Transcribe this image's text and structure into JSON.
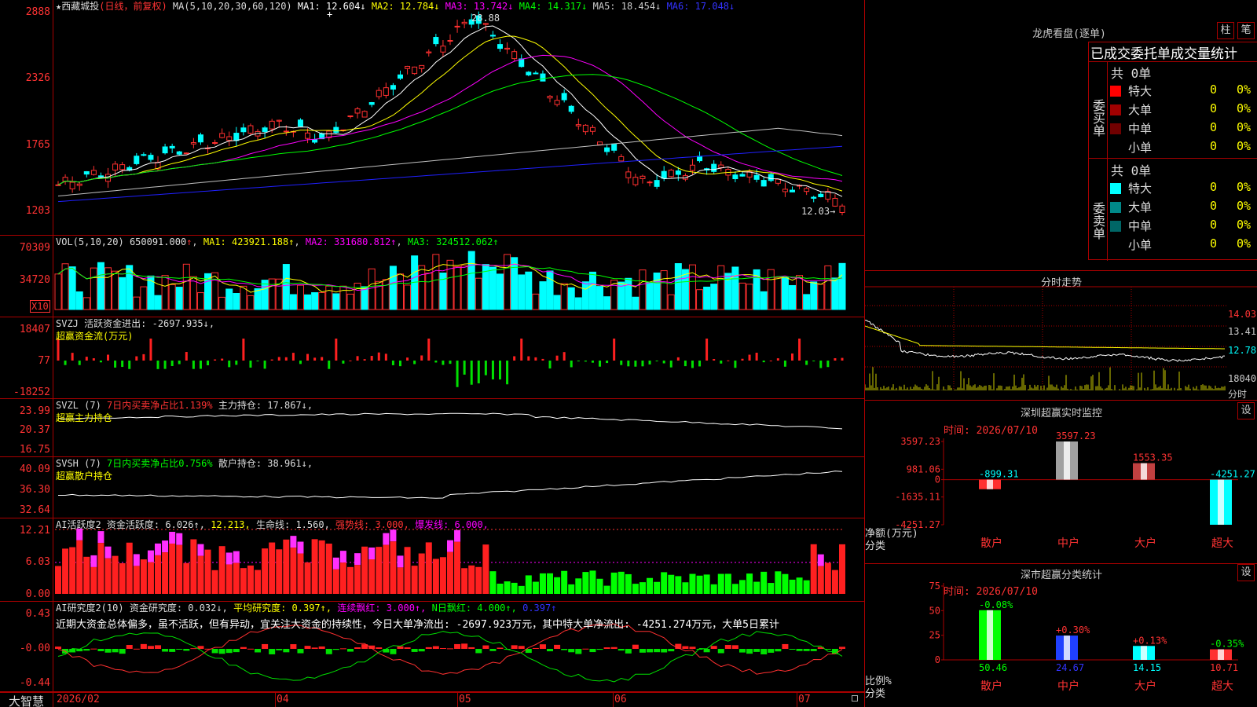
{
  "main": {
    "title": "★西藏城投",
    "period": "(日线，前复权)",
    "ma_label": "MA(5,10,20,30,60,120)",
    "ma": [
      {
        "name": "MA1: 12.604↓",
        "color": "#ffffff"
      },
      {
        "name": "MA2: 12.784↓",
        "color": "#ffff00"
      },
      {
        "name": "MA3: 13.742↓",
        "color": "#ff00ff"
      },
      {
        "name": "MA4: 14.317↓",
        "color": "#00ff00"
      },
      {
        "name": "MA5: 18.454↓",
        "color": "#c0c0c0"
      },
      {
        "name": "MA6: 17.048↓",
        "color": "#0000ff"
      }
    ],
    "yticks": [
      "2888",
      "2326",
      "1765",
      "1203"
    ],
    "high_label": "28.88",
    "low_label": "12.03→"
  },
  "vol": {
    "label": "VOL(5,10,20)",
    "value": "650091.000",
    "arrow": "↑",
    "ma1": "MA1: 423921.188↑",
    "ma2": "MA2: 331680.812↑",
    "ma3": "MA3: 324512.062↑",
    "yticks": [
      "70309",
      "34720"
    ],
    "unit": "X10"
  },
  "svzj": {
    "label": "SVZJ",
    "desc": "活跃资金进出: -2697.935↓,",
    "sub": "超赢资金流(万元)",
    "yticks": [
      "18407",
      "77",
      "-18252"
    ]
  },
  "svzl": {
    "label": "SVZL (7)",
    "desc1": "7日内买卖净占比1.139%",
    "desc2": "主力持仓: 17.867↓,",
    "sub": "超赢主力持仓",
    "yticks": [
      "23.99",
      "20.37",
      "16.75"
    ]
  },
  "svsh": {
    "label": "SVSH (7)",
    "desc1": "7日内买卖净占比0.756%",
    "desc2": "散户持仓: 38.961↓,",
    "sub": "超赢散户持仓",
    "yticks": [
      "40.09",
      "36.30",
      "32.64"
    ]
  },
  "ai1": {
    "label": "AI活跃度2",
    "a": "资金活跃度: 6.026↑,",
    "b": "12.213,",
    "c": "生命线: 1.560,",
    "d": "强势线: 3.000,",
    "e": "爆发线: 6.000,",
    "yticks": [
      "12.21",
      "6.03",
      "0.00"
    ]
  },
  "ai2": {
    "label": "AI研究度2(10)",
    "a": "资金研究度: 0.032↓,",
    "b": "平均研究度: 0.397↑,",
    "c": "连续飘红: 3.000↑,",
    "d": "N日飘红: 4.000↑,",
    "e": "0.397↑",
    "text": "近期大资金总体偏多，虽不活跃，但有异动，宜关注大资金的持续性，今日大单净流出: -2697.923万元，其中特大单净流出: -4251.274万元，大单5日累计",
    "yticks": [
      "0.43",
      "-0.00",
      "-0.44"
    ]
  },
  "bottom": {
    "brand": "大智慧",
    "dates": [
      "2026/02",
      "04",
      "05",
      "06",
      "07"
    ]
  },
  "right": {
    "lhb_title": "龙虎看盘(逐单)",
    "btn1": "柱",
    "btn2": "笔",
    "table_title": "已成交委托单成交量统计",
    "buy_side": "委买单",
    "sell_side": "委卖单",
    "buy_total": "共 0单",
    "sell_total": "共 0单",
    "buy_rows": [
      {
        "label": "特大",
        "n": "0",
        "p": "0%",
        "color": "#ff0000"
      },
      {
        "label": "大单",
        "n": "0",
        "p": "0%",
        "color": "#a00000"
      },
      {
        "label": "中单",
        "n": "0",
        "p": "0%",
        "color": "#700000"
      },
      {
        "label": "小单",
        "n": "0",
        "p": "0%",
        "color": "#000000"
      }
    ],
    "sell_rows": [
      {
        "label": "特大",
        "n": "0",
        "p": "0%",
        "color": "#00ffff"
      },
      {
        "label": "大单",
        "n": "0",
        "p": "0%",
        "color": "#008888"
      },
      {
        "label": "中单",
        "n": "0",
        "p": "0%",
        "color": "#006666"
      },
      {
        "label": "小单",
        "n": "0",
        "p": "0%",
        "color": "#000000"
      }
    ],
    "fs_title": "分时走势",
    "fs_yticks": [
      "14.03",
      "13.41",
      "12.78",
      "18040"
    ],
    "fs_unit": "分时",
    "sz_title": "深圳超赢实时监控",
    "sz_btn": "设",
    "sz_time": "时间: 2026/07/10",
    "sz_yticks": [
      "3597.23",
      "981.06",
      "0",
      "-1635.11",
      "-4251.27"
    ],
    "sz_ylabel": "净额(万元)",
    "sz_xlabel": "分类",
    "sz_cats": [
      "散户",
      "中户",
      "大户",
      "超大"
    ],
    "sz_vals_label": [
      "-899.31",
      "3597.23",
      "1553.35",
      "-4251.27"
    ],
    "cls_title": "深市超赢分类统计",
    "cls_btn": "设",
    "cls_time": "时间: 2026/07/10",
    "cls_yticks": [
      "75",
      "50",
      "25",
      "0"
    ],
    "cls_ylabel": "比例%",
    "cls_xlabel": "分类",
    "cls_cats": [
      "散户",
      "中户",
      "大户",
      "超大"
    ],
    "cls_vals_label": [
      "50.46",
      "24.67",
      "14.15",
      "10.71"
    ],
    "cls_chg_label": [
      "-0.08%",
      "+0.30%",
      "+0.13%",
      "-0.35%"
    ]
  },
  "chart_data": [
    {
      "type": "bar",
      "title": "深圳超赢实时监控",
      "categories": [
        "散户",
        "中户",
        "大户",
        "超大"
      ],
      "values": [
        -899.31,
        3597.23,
        1553.35,
        -4251.27
      ],
      "ylabel": "净额(万元)",
      "ylim": [
        -4251.27,
        3597.23
      ]
    },
    {
      "type": "bar",
      "title": "深市超赢分类统计",
      "categories": [
        "散户",
        "中户",
        "大户",
        "超大"
      ],
      "values": [
        50.46,
        24.67,
        14.15,
        10.71
      ],
      "changes": [
        "-0.08%",
        "+0.30%",
        "+0.13%",
        "-0.35%"
      ],
      "ylabel": "比例%",
      "ylim": [
        0,
        75
      ]
    }
  ]
}
